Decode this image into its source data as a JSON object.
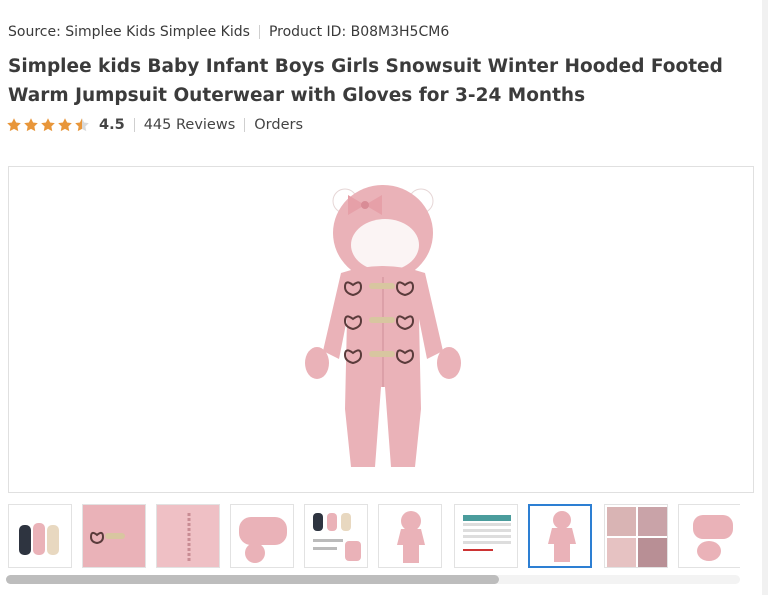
{
  "meta": {
    "source": "Source: Simplee Kids Simplee Kids",
    "product_id": "Product ID: B08M3H5CM6"
  },
  "product": {
    "title": "Simplee kids Baby Infant Boys Girls Snowsuit Winter Hooded Footed Warm Jumpsuit Outerwear with Gloves for 3-24 Months"
  },
  "rating": {
    "value": "4.5",
    "stars": 4.5,
    "reviews": "445 Reviews",
    "orders": "Orders"
  },
  "colors": {
    "star": "#e8963a",
    "star_empty": "#d9d9d9",
    "suit_pink": "#eab2b8",
    "selected_border": "#2d7fd3"
  },
  "gallery": {
    "thumbnails": [
      {
        "name": "thumb-color-variants"
      },
      {
        "name": "thumb-toggle-detail"
      },
      {
        "name": "thumb-zipper-detail"
      },
      {
        "name": "thumb-gloves"
      },
      {
        "name": "thumb-variants-info"
      },
      {
        "name": "thumb-front-view"
      },
      {
        "name": "thumb-size-chart"
      },
      {
        "name": "thumb-main-selected",
        "selected": true
      },
      {
        "name": "thumb-lifestyle-collage"
      },
      {
        "name": "thumb-sleeve-detail"
      }
    ]
  }
}
